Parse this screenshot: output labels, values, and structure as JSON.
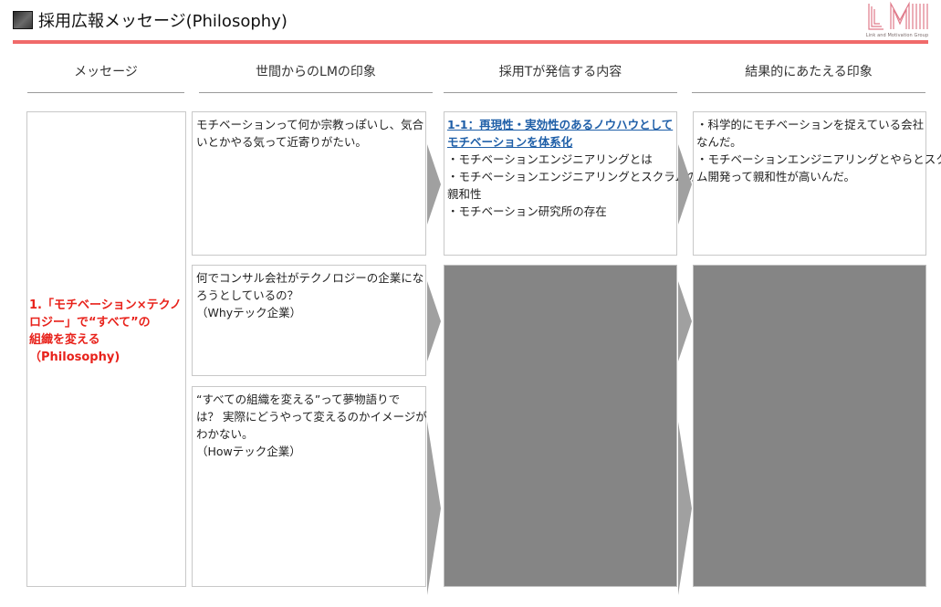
{
  "header": {
    "title": "採用広報メッセージ(Philosophy)",
    "logo_caption": "Link and Motivation Group"
  },
  "columns": [
    {
      "label": "メッセージ"
    },
    {
      "label": "世間からのLMの印象"
    },
    {
      "label": "採用Tが発信する内容"
    },
    {
      "label": "結果的にあたえる印象"
    }
  ],
  "message": {
    "lines": [
      "1.「モチベーション×テクノ",
      "ロジー」で“すべて”の",
      "組織を変える",
      "（Philosophy)"
    ]
  },
  "impressions": [
    {
      "lines": [
        "モチベーションって何か宗教っぽいし、気合",
        "いとかやる気って近寄りがたい。"
      ]
    },
    {
      "lines": [
        "何でコンサル会社がテクノロジーの企業にな",
        "ろうとしているの？",
        "（Whyテック企業）"
      ]
    },
    {
      "lines": [
        "“すべての組織を変える”って夢物語りで",
        "は？ 実際にどうやって変えるのかイメージが",
        "わかない。",
        "（Howテック企業）"
      ]
    }
  ],
  "content": {
    "heading_lines": [
      "1-1：再現性・実効性のあるノウハウとして",
      "モチベーションを体系化"
    ],
    "items": [
      "・モチベーションエンジニアリングとは",
      "・モチベーションエンジニアリングとスクラムの",
      "親和性",
      "・モチベーション研究所の存在"
    ]
  },
  "result": {
    "lines": [
      "・科学的にモチベーションを捉えている会社",
      "なんだ。",
      "・モチベーションエンジニアリングとやらとスクラ",
      "ム開発って親和性が高いんだ。"
    ]
  },
  "colors": {
    "accent_red": "#f06a6a",
    "message_red": "#e8221b",
    "link_blue": "#1f5fa8",
    "placeholder_gray": "#858585"
  }
}
